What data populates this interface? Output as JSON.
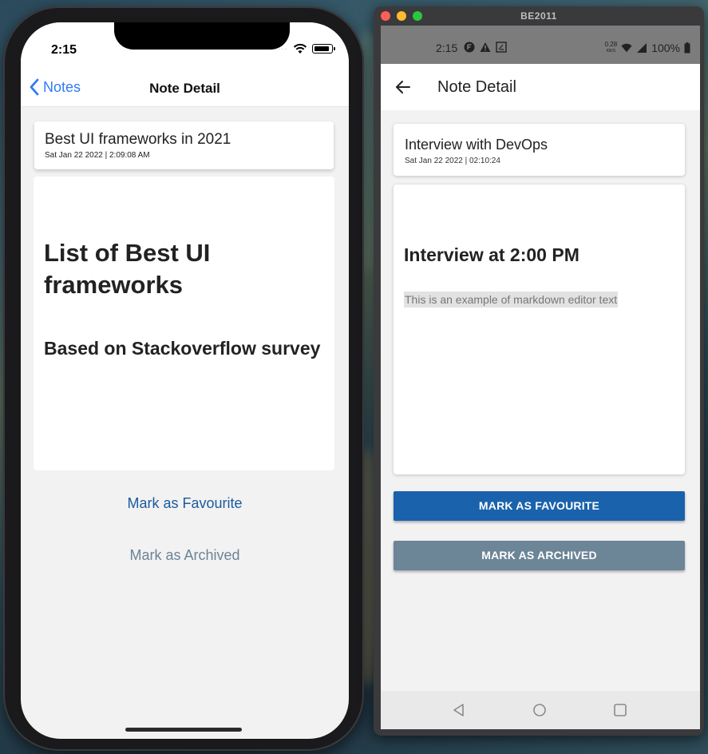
{
  "ios": {
    "status_time": "2:15",
    "nav": {
      "back_label": "Notes",
      "title": "Note Detail"
    },
    "note": {
      "title": "Best UI frameworks in 2021",
      "date": "Sat Jan 22 2022 | 2:09:08 AM",
      "heading1": "List of Best UI frameworks",
      "heading2": "Based on Stackoverflow survey"
    },
    "actions": {
      "favourite": "Mark as Favourite",
      "archived": "Mark as Archived"
    }
  },
  "mac_window": {
    "title": "BE2011"
  },
  "android": {
    "status_time": "2:15",
    "status_speed_top": "0.28",
    "status_speed_bottom": "KB/S",
    "battery": "100%",
    "toolbar_title": "Note Detail",
    "note": {
      "title": "Interview with DevOps",
      "date": "Sat Jan 22 2022 | 02:10:24",
      "heading1": "Interview at 2:00 PM",
      "markdown_text": "This is an example of markdown editor text"
    },
    "actions": {
      "favourite": "MARK AS FAVOURITE",
      "archived": "MARK AS ARCHIVED"
    }
  },
  "colors": {
    "ios_link": "#2f7bf6",
    "ios_favourite": "#1b5a9e",
    "ios_archived": "#6c8397",
    "android_favourite": "#1a62ac",
    "android_archived": "#6c8597"
  }
}
